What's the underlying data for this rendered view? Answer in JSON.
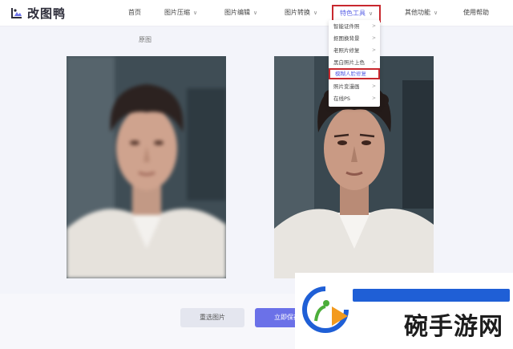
{
  "app": {
    "logo_text": "改图鸭"
  },
  "nav": {
    "items": [
      {
        "label": "首页",
        "has_menu": false
      },
      {
        "label": "图片压缩",
        "has_menu": true
      },
      {
        "label": "图片编辑",
        "has_menu": true
      },
      {
        "label": "图片转换",
        "has_menu": true
      },
      {
        "label": "特色工具",
        "has_menu": true,
        "active": true
      },
      {
        "label": "其他功能",
        "has_menu": true
      },
      {
        "label": "使用帮助",
        "has_menu": false
      }
    ]
  },
  "dropdown": {
    "items": [
      {
        "label": "智能证件照"
      },
      {
        "label": "抠图换背景"
      },
      {
        "label": "老照片修复"
      },
      {
        "label": "黑白照片上色"
      },
      {
        "label": "模糊人脸修复",
        "highlighted": true
      },
      {
        "label": "照片变漫画"
      },
      {
        "label": "在线PS"
      }
    ]
  },
  "main": {
    "original_label": "原图",
    "reselect_button": "重选图片",
    "save_button": "立即保存"
  },
  "watermark": {
    "text": "碗手游网"
  },
  "colors": {
    "accent": "#6b71e8",
    "highlight_border": "#c8282e",
    "watermark_blue": "#1f5fd6",
    "watermark_orange": "#f39a1d",
    "watermark_green": "#4cae3a"
  }
}
